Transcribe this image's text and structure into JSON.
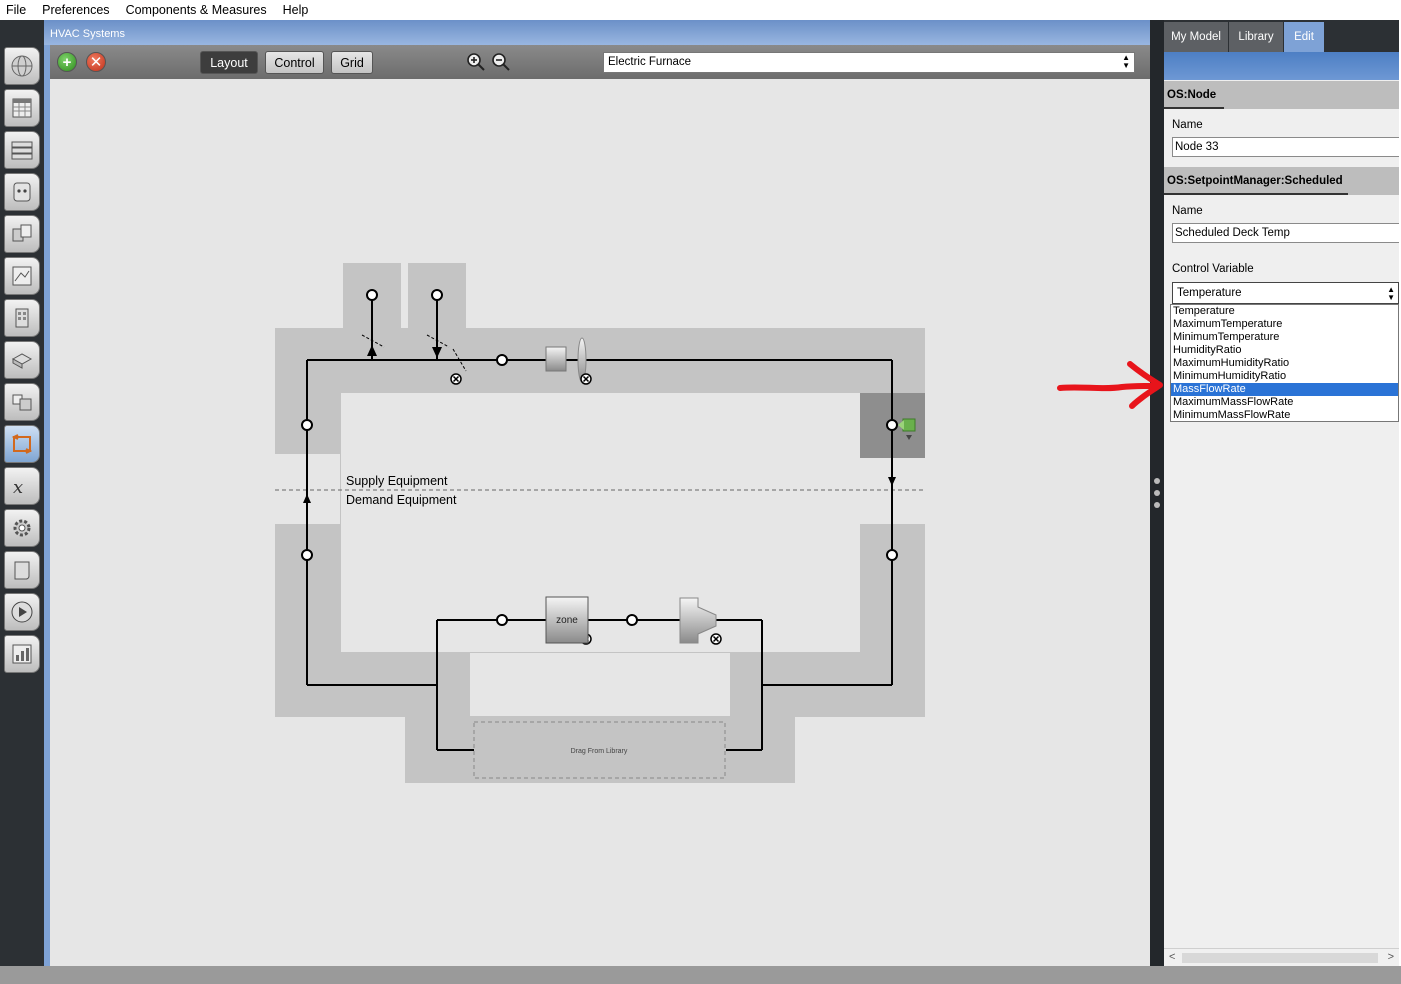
{
  "menubar": {
    "items": [
      "File",
      "Preferences",
      "Components & Measures",
      "Help"
    ]
  },
  "left_tabs": [
    {
      "icon": "globe-icon"
    },
    {
      "icon": "calendar-icon"
    },
    {
      "icon": "constructions-icon"
    },
    {
      "icon": "loads-icon"
    },
    {
      "icon": "space-types-icon"
    },
    {
      "icon": "geometry-icon"
    },
    {
      "icon": "facility-icon"
    },
    {
      "icon": "spaces-icon"
    },
    {
      "icon": "thermal-zones-icon"
    },
    {
      "icon": "hvac-systems-icon",
      "active": true
    },
    {
      "icon": "variables-icon"
    },
    {
      "icon": "simulation-settings-icon"
    },
    {
      "icon": "scripts-icon"
    },
    {
      "icon": "run-icon"
    },
    {
      "icon": "results-icon"
    }
  ],
  "hvac": {
    "title": "HVAC Systems",
    "toolbar": {
      "add_label": "+",
      "remove_label": "✕",
      "layout_label": "Layout",
      "control_label": "Control",
      "grid_label": "Grid",
      "loop_select": "Electric Furnace"
    },
    "diagram": {
      "supply_label": "Supply Equipment",
      "demand_label": "Demand Equipment",
      "zone_label": "zone",
      "drop_label": "Drag From Library"
    }
  },
  "right_panel": {
    "tabs": [
      "My Model",
      "Library",
      "Edit"
    ],
    "active_tab": "Edit",
    "node_section": "OS:Node",
    "node_name_label": "Name",
    "node_name_value": "Node 33",
    "spm_section": "OS:SetpointManager:Scheduled",
    "spm_name_label": "Name",
    "spm_name_value": "Scheduled Deck Temp",
    "control_variable_label": "Control Variable",
    "control_variable_value": "Temperature",
    "options": [
      "Temperature",
      "MaximumTemperature",
      "MinimumTemperature",
      "HumidityRatio",
      "MaximumHumidityRatio",
      "MinimumHumidityRatio",
      "MassFlowRate",
      "MaximumMassFlowRate",
      "MinimumMassFlowRate"
    ],
    "highlighted_option": "MassFlowRate",
    "scroll_left": "<",
    "scroll_right": ">"
  },
  "colors": {
    "accent_blue": "#7ea2d6",
    "selection_blue": "#2a73d6",
    "annotation_red": "#e8141b"
  }
}
